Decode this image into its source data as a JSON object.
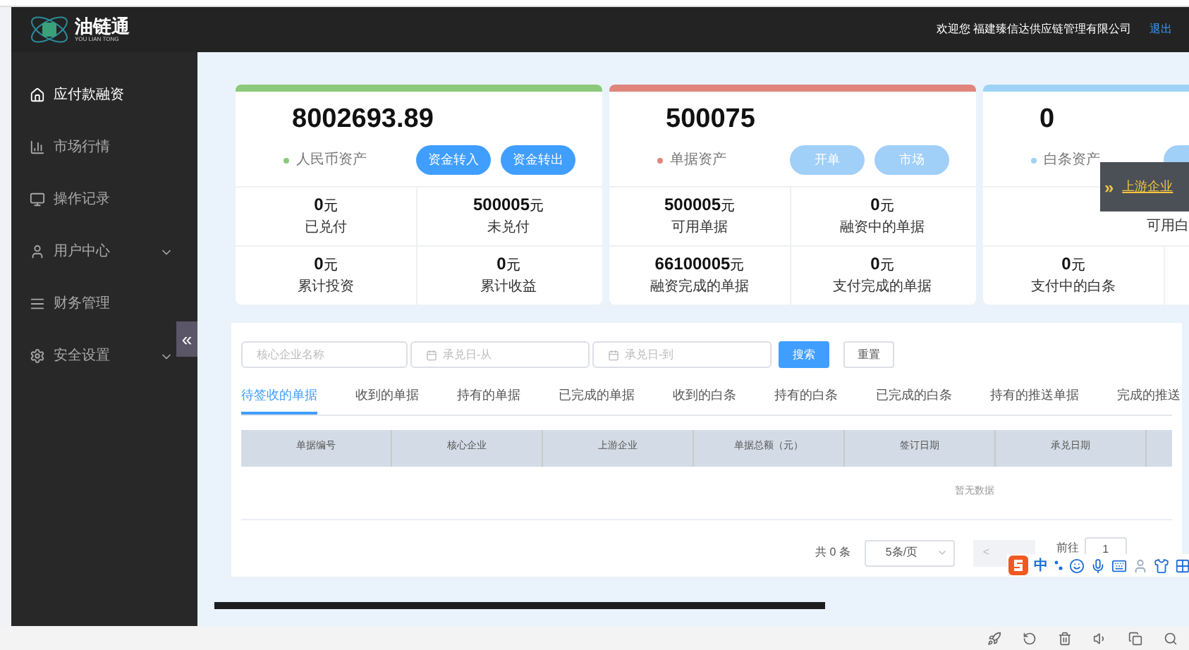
{
  "logo": {
    "name": "油链通",
    "subtitle": "YOU LIAN TONG"
  },
  "header": {
    "welcome": "欢迎您 福建臻信达供应链管理有限公司",
    "logout": "退出"
  },
  "sidebar": {
    "items": [
      {
        "label": "应付款融资",
        "selected": true
      },
      {
        "label": "市场行情",
        "selected": false
      },
      {
        "label": "操作记录",
        "selected": false
      },
      {
        "label": "用户中心",
        "selected": false,
        "expanded": false
      },
      {
        "label": "财务管理",
        "selected": false
      },
      {
        "label": "安全设置",
        "selected": false,
        "expanded": false
      }
    ],
    "collapse": "«"
  },
  "cards": [
    {
      "color": "#8cc97a",
      "amount": "8002693.89",
      "label": "人民币资产",
      "buttons": [
        {
          "label": "资金转入",
          "disabled": false
        },
        {
          "label": "资金转出",
          "disabled": false
        }
      ],
      "stats": [
        [
          {
            "value": "0",
            "unit": "元",
            "label": "已兑付"
          },
          {
            "value": "500005",
            "unit": "元",
            "label": "未兑付"
          }
        ],
        [
          {
            "value": "0",
            "unit": "元",
            "label": "累计投资"
          },
          {
            "value": "0",
            "unit": "元",
            "label": "累计收益"
          }
        ]
      ]
    },
    {
      "color": "#e0847c",
      "amount": "500075",
      "label": "单据资产",
      "buttons": [
        {
          "label": "开单",
          "disabled": true
        },
        {
          "label": "市场",
          "disabled": true
        }
      ],
      "stats": [
        [
          {
            "value": "500005",
            "unit": "元",
            "label": "可用单据"
          },
          {
            "value": "0",
            "unit": "元",
            "label": "融资中的单据"
          }
        ],
        [
          {
            "value": "66100005",
            "unit": "元",
            "label": "融资完成的单据"
          },
          {
            "value": "0",
            "unit": "元",
            "label": "支付完成的单据"
          }
        ]
      ]
    },
    {
      "color": "#9fd3f5",
      "amount": "0",
      "label": "白条资产",
      "buttons": [
        {
          "disabled": true
        }
      ],
      "stats": [
        [
          {
            "label": "可用白",
            "kind": "edge"
          }
        ],
        [
          {
            "value": "0",
            "unit": "元",
            "label": "支付中的白条"
          }
        ]
      ]
    }
  ],
  "flyout": {
    "icon": "»",
    "label": "上游企业"
  },
  "filters": {
    "fields": [
      {
        "placeholder": "核心企业名称",
        "kind": "text"
      },
      {
        "placeholder": "承兑日-从",
        "kind": "date"
      },
      {
        "placeholder": "承兑日-到",
        "kind": "date"
      }
    ],
    "search": "搜索",
    "reset": "重置"
  },
  "tabs": [
    {
      "label": "待签收的单据",
      "selected": true
    },
    {
      "label": "收到的单据",
      "selected": false
    },
    {
      "label": "持有的单据",
      "selected": false
    },
    {
      "label": "已完成的单据",
      "selected": false
    },
    {
      "label": "收到的白条",
      "selected": false
    },
    {
      "label": "持有的白条",
      "selected": false
    },
    {
      "label": "已完成的白条",
      "selected": false
    },
    {
      "label": "持有的推送单据",
      "selected": false
    },
    {
      "label": "完成的推送",
      "selected": false
    }
  ],
  "table": {
    "columns": [
      "单据编号",
      "核心企业",
      "上游企业",
      "单据总额（元）",
      "签订日期",
      "承兑日期"
    ],
    "empty": "暂无数据"
  },
  "pagination": {
    "total": "共 0 条",
    "page_size": "5条/页",
    "prev": "<",
    "goto": "前往",
    "page": "1"
  },
  "ime": {
    "mode": "中"
  }
}
